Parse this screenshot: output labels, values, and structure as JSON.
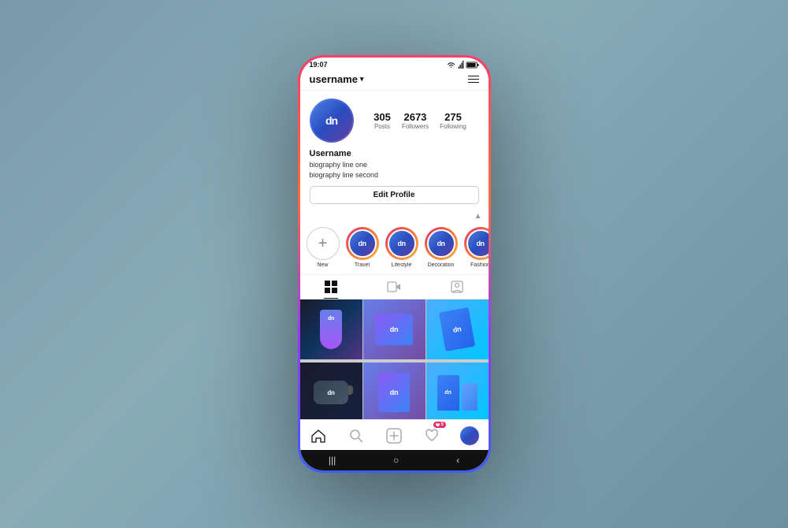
{
  "phone": {
    "status_bar": {
      "time": "19:07",
      "signal": "WiFi",
      "battery": "■"
    },
    "header": {
      "username": "username",
      "menu_label": "menu"
    },
    "profile": {
      "avatar_text": "dn",
      "stats": [
        {
          "number": "305",
          "label": "Posts"
        },
        {
          "number": "2673",
          "label": "Followers"
        },
        {
          "number": "275",
          "label": "Following"
        }
      ],
      "name": "Username",
      "bio_line1": "biography line one",
      "bio_line2": "biography line second",
      "edit_button": "Edit Profile"
    },
    "stories": [
      {
        "label": "New",
        "type": "new"
      },
      {
        "label": "Travel",
        "type": "story",
        "avatar": "dn"
      },
      {
        "label": "Lifestyle",
        "type": "story",
        "avatar": "dn"
      },
      {
        "label": "Decoration",
        "type": "story",
        "avatar": "dn"
      },
      {
        "label": "Fashion",
        "type": "story",
        "avatar": "dn"
      }
    ],
    "tabs": [
      {
        "id": "grid",
        "active": true
      },
      {
        "id": "video",
        "active": false
      },
      {
        "id": "tagged",
        "active": false
      }
    ],
    "grid": {
      "items": [
        {
          "type": "sock",
          "color1": "#1a1a2e",
          "color2": "#0f3460"
        },
        {
          "type": "tshirt",
          "color1": "#667eea",
          "color2": "#764ba2"
        },
        {
          "type": "book",
          "color1": "#4facfe",
          "color2": "#00f2fe"
        },
        {
          "type": "mouse",
          "color1": "#1a1a2e",
          "color2": "#16213e"
        },
        {
          "type": "notebook",
          "color1": "#667eea",
          "color2": "#764ba2"
        },
        {
          "type": "bag",
          "color1": "#4facfe",
          "color2": "#00f2fe"
        },
        {
          "type": "bottom",
          "color1": "#667eea",
          "color2": "#764ba2"
        }
      ]
    },
    "bottom_nav": {
      "items": [
        "home",
        "search",
        "add",
        "heart",
        "profile"
      ],
      "heart_badge": "5"
    },
    "android_nav": {
      "items": [
        "|||",
        "○",
        "‹"
      ]
    }
  }
}
